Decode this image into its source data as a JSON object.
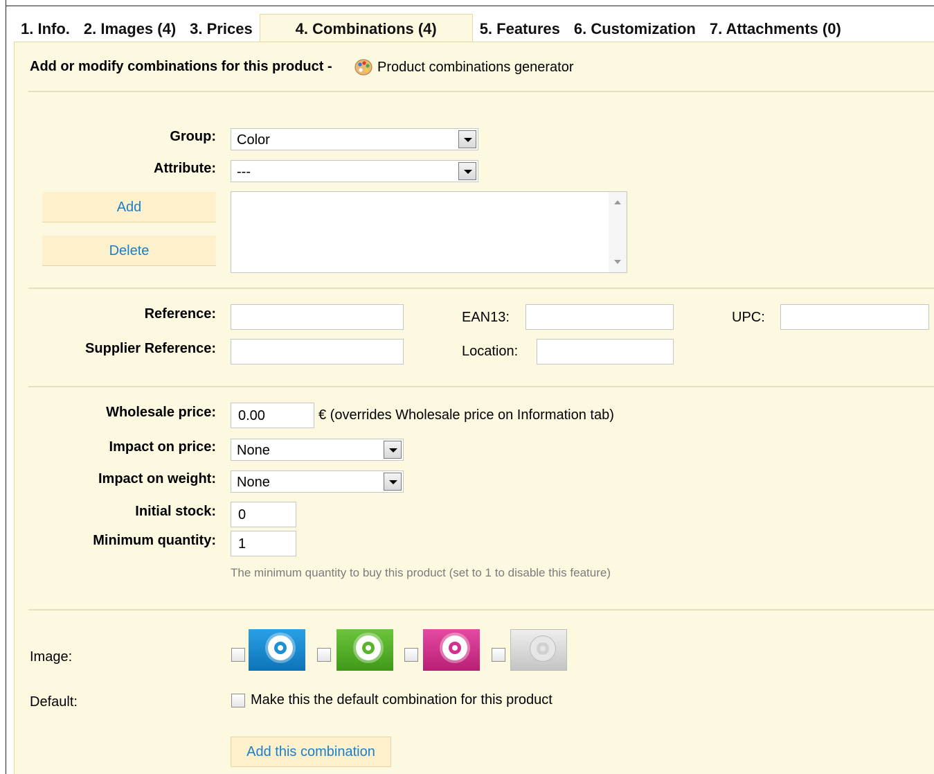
{
  "tabs": [
    {
      "label": "1. Info."
    },
    {
      "label": "2. Images (4)"
    },
    {
      "label": "3. Prices"
    },
    {
      "label": "4. Combinations (4)",
      "active": true
    },
    {
      "label": "5. Features"
    },
    {
      "label": "6. Customization"
    },
    {
      "label": "7. Attachments (0)"
    }
  ],
  "header": {
    "heading": "Add or modify combinations for this product -",
    "generator_link": "Product combinations generator",
    "generator_icon": "palette-icon"
  },
  "attributes": {
    "group_label": "Group:",
    "group_value": "Color",
    "attribute_label": "Attribute:",
    "attribute_value": "---",
    "add_button": "Add",
    "delete_button": "Delete"
  },
  "references": {
    "reference_label": "Reference:",
    "reference_value": "",
    "ean13_label": "EAN13:",
    "ean13_value": "",
    "upc_label": "UPC:",
    "upc_value": "",
    "supplier_reference_label": "Supplier Reference:",
    "supplier_reference_value": "",
    "location_label": "Location:",
    "location_value": ""
  },
  "pricing": {
    "wholesale_label": "Wholesale price:",
    "wholesale_value": "0.00",
    "wholesale_note": "€ (overrides Wholesale price on Information tab)",
    "impact_price_label": "Impact on price:",
    "impact_price_value": "None",
    "impact_weight_label": "Impact on weight:",
    "impact_weight_value": "None",
    "initial_stock_label": "Initial stock:",
    "initial_stock_value": "0",
    "min_qty_label": "Minimum quantity:",
    "min_qty_value": "1",
    "min_qty_hint": "The minimum quantity to buy this product (set to 1 to disable this feature)"
  },
  "images": {
    "label": "Image:",
    "items": [
      {
        "name": "ipod-blue",
        "color": "#1a8fd6"
      },
      {
        "name": "ipod-green",
        "color": "#58b52b"
      },
      {
        "name": "ipod-pink",
        "color": "#d42f8f"
      },
      {
        "name": "ipod-silver",
        "color": "#cfcfcf"
      }
    ]
  },
  "default": {
    "label": "Default:",
    "checkbox_label": "Make this the default combination for this product"
  },
  "submit_button": "Add this combination"
}
